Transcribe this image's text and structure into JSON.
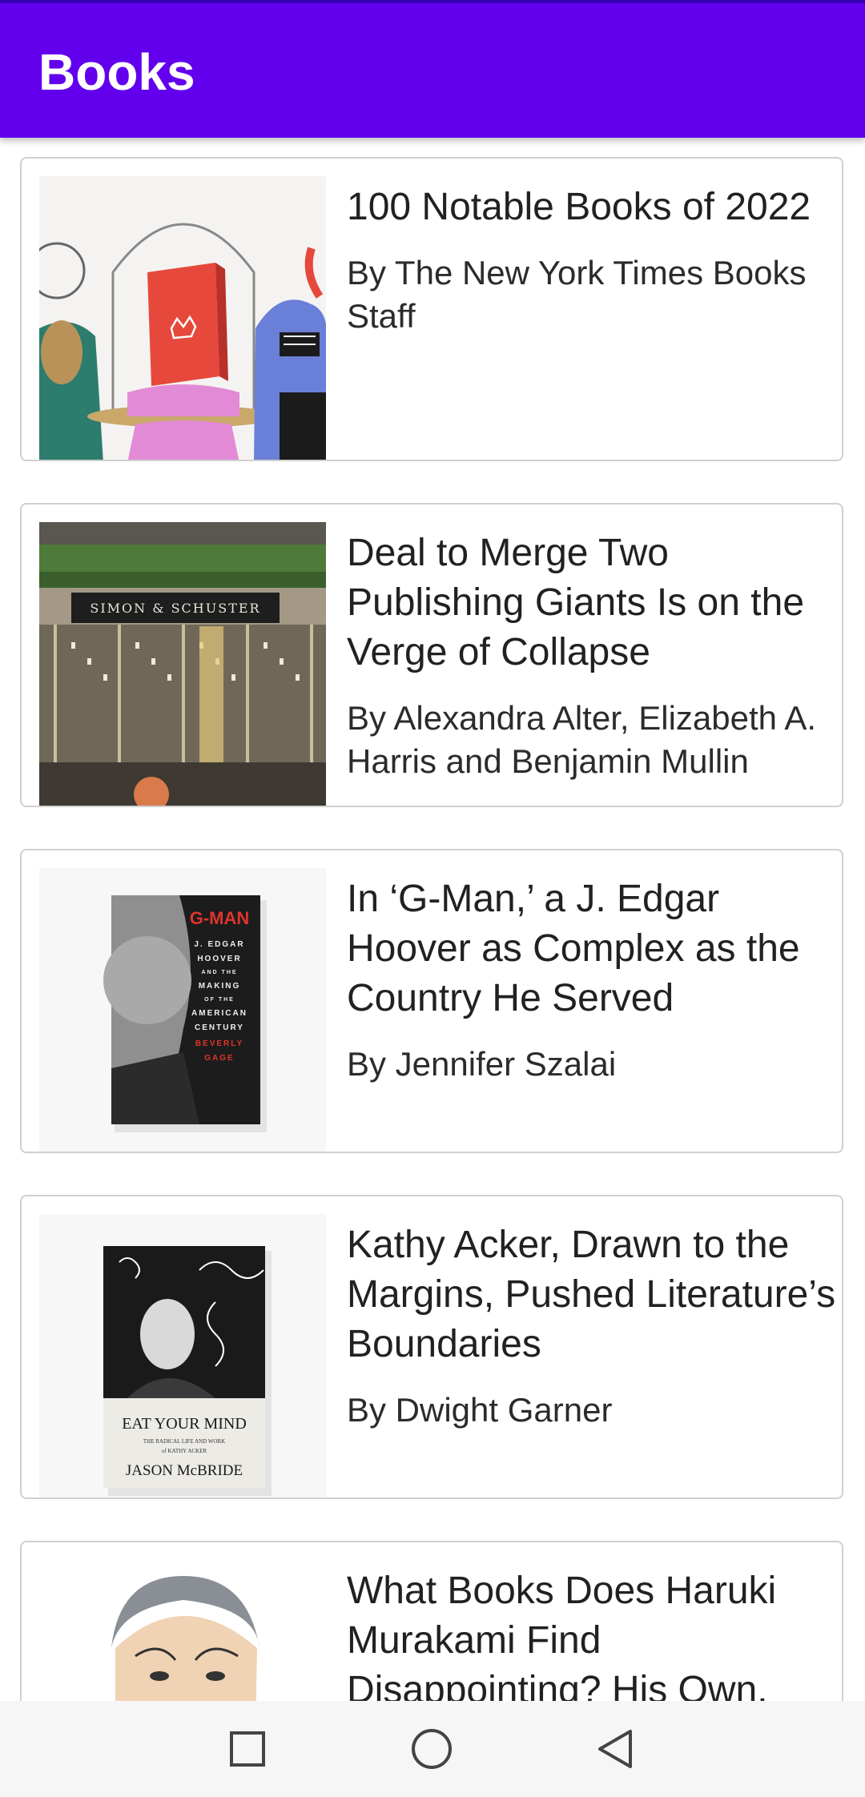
{
  "app": {
    "title": "Books"
  },
  "articles": [
    {
      "title": "100 Notable Books of 2022",
      "byline": "By The New York Times Books Staff",
      "image": "illustrated-book-under-glass-dome"
    },
    {
      "title": "Deal to Merge Two Publishing Giants Is on the Verge of Collapse",
      "byline": "By Alexandra Alter, Elizabeth A. Harris and Benjamin Mullin",
      "image": "simon-schuster-building",
      "image_text": "SIMON & SCHUSTER"
    },
    {
      "title": "In ‘G-Man,’ a J. Edgar Hoover as Complex as the Country He Served",
      "byline": "By Jennifer Szalai",
      "image": "g-man-book-cover",
      "cover": {
        "title": "G-MAN",
        "lines": [
          "J. EDGAR",
          "HOOVER",
          "AND THE",
          "MAKING",
          "OF THE",
          "AMERICAN",
          "CENTURY"
        ],
        "author_1": "BEVERLY",
        "author_2": "GAGE"
      }
    },
    {
      "title": "Kathy Acker, Drawn to the Margins, Pushed Literature’s Boundaries",
      "byline": "By Dwight Garner",
      "image": "eat-your-mind-book-cover",
      "cover": {
        "title": "EAT YOUR MIND",
        "subtitle_1": "THE RADICAL LIFE AND WORK",
        "subtitle_2": "of KATHY ACKER",
        "author": "JASON McBRIDE"
      }
    },
    {
      "title": "What Books Does Haruki Murakami Find Disappointing? His Own.",
      "byline": "",
      "image": "haruki-murakami-illustration"
    }
  ],
  "navbar": {
    "recents": "square-icon",
    "home": "circle-icon",
    "back": "triangle-back-icon"
  },
  "colors": {
    "primary": "#6200EE",
    "primary_dark": "#3700B3",
    "card_border": "#d0d0d0"
  }
}
